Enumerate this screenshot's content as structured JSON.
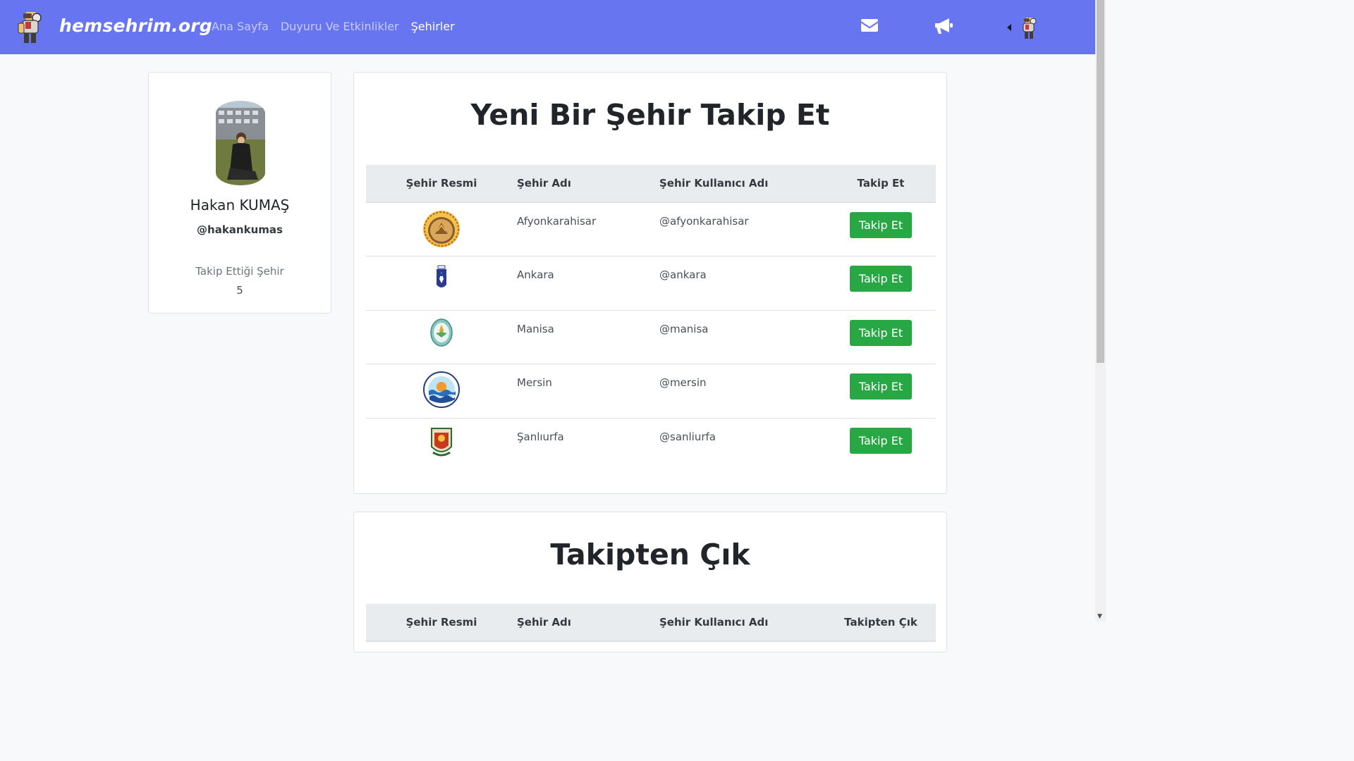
{
  "navbar": {
    "brand": "hemsehrim.org",
    "links": [
      {
        "label": "Ana Sayfa",
        "active": false
      },
      {
        "label": "Duyuru Ve Etkinlikler",
        "active": false
      },
      {
        "label": "Şehirler",
        "active": true
      }
    ],
    "icons": [
      "envelope-icon",
      "megaphone-icon",
      "caret-left-icon"
    ]
  },
  "profile": {
    "name": "Hakan KUMAŞ",
    "username": "@hakankumas",
    "follow_label": "Takip Ettiği Şehir",
    "follow_count": "5"
  },
  "follow_section": {
    "title": "Yeni Bir Şehir Takip Et",
    "headers": [
      "Şehir Resmi",
      "Şehir Adı",
      "Şehir Kullanıcı Adı",
      "Takip Et"
    ],
    "rows": [
      {
        "city": "Afyonkarahisar",
        "handle": "@afyonkarahisar",
        "button": "Takip Et"
      },
      {
        "city": "Ankara",
        "handle": "@ankara",
        "button": "Takip Et"
      },
      {
        "city": "Manisa",
        "handle": "@manisa",
        "button": "Takip Et"
      },
      {
        "city": "Mersin",
        "handle": "@mersin",
        "button": "Takip Et"
      },
      {
        "city": "Şanlıurfa",
        "handle": "@sanliurfa",
        "button": "Takip Et"
      }
    ]
  },
  "unfollow_section": {
    "title": "Takipten Çık",
    "headers": [
      "Şehir Resmi",
      "Şehir Adı",
      "Şehir Kullanıcı Adı",
      "Takipten Çık"
    ]
  },
  "colors": {
    "navbar": "#6875f0",
    "follow_button": "#28a745",
    "table_header": "#e9ecef"
  }
}
